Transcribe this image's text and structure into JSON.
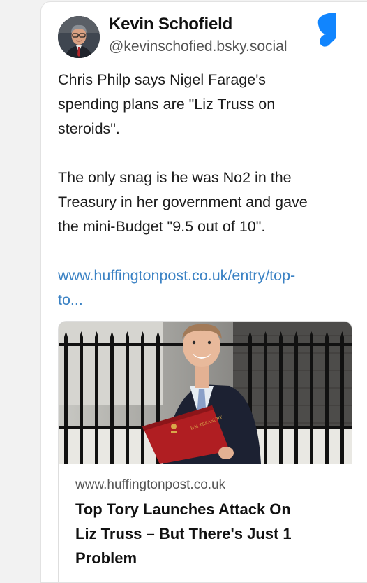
{
  "post": {
    "author": {
      "name": "Kevin Schofield",
      "handle": "@kevinschofied.bsky.social"
    },
    "logo_icon": "bluesky-butterfly-icon",
    "text_lines_1": [
      "Chris Philp says Nigel Farage's",
      "spending plans are \"Liz Truss on",
      "steroids\"."
    ],
    "text_lines_2": [
      "The only snag is he was No2 in the",
      "Treasury in her government and gave",
      "the mini-Budget \"9.5 out of 10\"."
    ],
    "link_lines": [
      "www.huffingtonpost.co.uk/entry/top-",
      "to..."
    ]
  },
  "embed": {
    "domain": "www.huffingtonpost.co.uk",
    "title_lines": [
      "Top Tory Launches Attack On",
      "Liz Truss – But There's Just 1",
      "Problem"
    ]
  },
  "colors": {
    "link": "#3b82c4",
    "bluesky": "#1185fe",
    "folder": "#b01e22"
  }
}
